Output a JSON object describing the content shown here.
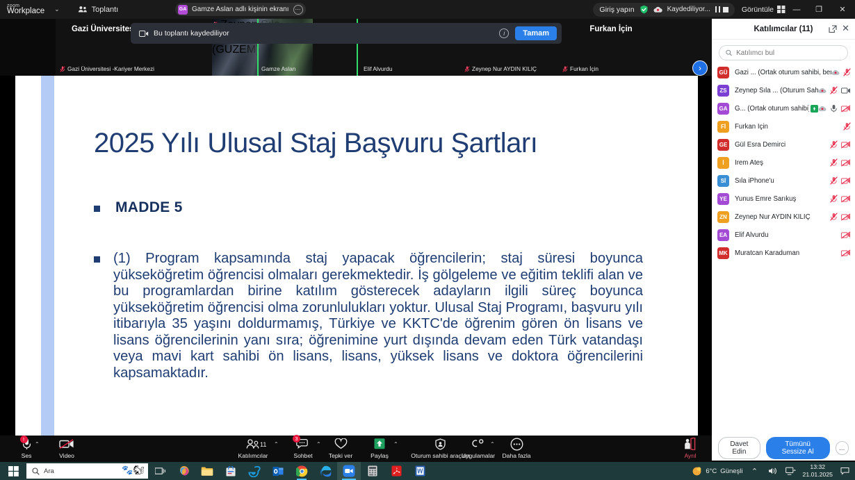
{
  "topbar": {
    "logo_small": "zoom",
    "logo_main": "Workplace",
    "meetings_label": "Toplantı",
    "share_indicator": {
      "initials": "GA",
      "text": "Gamze Aslan adlı kişinin ekranı"
    },
    "signin_label": "Giriş yapın",
    "recording_label": "Kaydediliyor...",
    "view_label": "Görüntüle",
    "window_minimize": "—",
    "window_restore": "❐",
    "window_close": "✕"
  },
  "recording_banner": {
    "text": "Bu toplantı kaydediliyor",
    "info": "i",
    "ok_label": "Tamam"
  },
  "filmstrip": {
    "tiles": [
      {
        "display_name": "Gazi Üniversites...",
        "bottom_name": "Gazi Üniversitesi -Kariyer Merkezi",
        "muted": true,
        "video": false,
        "active": false
      },
      {
        "display_name": "",
        "bottom_name": "Zeynep Sıla PEHLİVAN (GUZEM)",
        "muted": true,
        "video": true,
        "active": false
      },
      {
        "display_name": "Gamze Aslan",
        "bottom_name": "Gamze Aslan",
        "muted": false,
        "video": false,
        "active": true
      },
      {
        "display_name": "Elif Alvurdu",
        "bottom_name": "Elif Alvurdu",
        "muted": false,
        "video": false,
        "active": false
      },
      {
        "display_name": "Zeynep Nur AY...",
        "bottom_name": "Zeynep Nur AYDIN KILIÇ",
        "muted": true,
        "video": false,
        "active": false
      },
      {
        "display_name": "Furkan İçin",
        "bottom_name": "Furkan İçin",
        "muted": true,
        "video": false,
        "active": false
      }
    ],
    "next_arrow": "›"
  },
  "slide": {
    "title": "2025 Yılı Ulusal Staj Başvuru Şartları",
    "bullet1": "MADDE 5",
    "bullet2": "(1) Program kapsamında staj yapacak öğrencilerin; staj süresi boyunca yükseköğretim öğrencisi olmaları gerekmektedir. İş gölgeleme ve eğitim teklifi alan ve bu programlardan birine katılım gösterecek adayların ilgili süreç boyunca yükseköğretim öğrencisi olma zorunlulukları yoktur. Ulusal Staj Programı, başvuru yılı itibarıyla 35 yaşını doldurmamış, Türkiye ve KKTC'de öğrenim gören ön lisans ve lisans öğrencilerinin yanı sıra; öğrenimine yurt dışında devam eden Türk vatandaşı veya mavi kart sahibi ön lisans, lisans, yüksek lisans ve doktora öğrencilerini kapsamaktadır.",
    "accent_color": "#b4cbf5",
    "text_color": "#1f3d73"
  },
  "participants_panel": {
    "title": "Katılımcılar (11)",
    "search_placeholder": "Katılımcı bul",
    "search_value": "",
    "invite_label": "Davet Edin",
    "mute_all_label": "Tümünü Sessize Al",
    "more_label": "...",
    "rows": [
      {
        "initials": "GÜ",
        "color": "#d22d2d",
        "name": "Gazi ...  (Ortak oturum sahibi, ben)",
        "recording": true,
        "mic": "muted",
        "cam": "none",
        "cohost_badge": false
      },
      {
        "initials": "ZS",
        "color": "#7b3fd4",
        "name": "Zeynep Sıla ... (Oturum Sahibi)",
        "recording": true,
        "mic": "muted",
        "cam": "on",
        "cohost_badge": false
      },
      {
        "initials": "GA",
        "color": "#a44bd6",
        "name": "G...  (Ortak oturum sahibi)",
        "recording": true,
        "mic": "on",
        "cam": "off",
        "cohost_badge": true
      },
      {
        "initials": "Fİ",
        "color": "#f0a020",
        "name": "Furkan İçin",
        "recording": false,
        "mic": "muted",
        "cam": "none",
        "cohost_badge": false
      },
      {
        "initials": "GE",
        "color": "#d22d2d",
        "name": "Gül Esra Demirci",
        "recording": false,
        "mic": "muted",
        "cam": "off",
        "cohost_badge": false
      },
      {
        "initials": "İ",
        "color": "#f0a020",
        "name": "İrem Ateş",
        "recording": false,
        "mic": "muted",
        "cam": "off",
        "cohost_badge": false
      },
      {
        "initials": "Sİ",
        "color": "#3a8fd4",
        "name": "Sıla iPhone'u",
        "recording": false,
        "mic": "muted",
        "cam": "off",
        "cohost_badge": false
      },
      {
        "initials": "YE",
        "color": "#a44bd6",
        "name": "Yunus Emre Sarıkuş",
        "recording": false,
        "mic": "muted",
        "cam": "off",
        "cohost_badge": false
      },
      {
        "initials": "ZN",
        "color": "#f0a020",
        "name": "Zeynep Nur AYDIN KILIÇ",
        "recording": false,
        "mic": "muted",
        "cam": "off",
        "cohost_badge": false
      },
      {
        "initials": "EA",
        "color": "#a44bd6",
        "name": "Elif Alvurdu",
        "recording": false,
        "mic": "none",
        "cam": "off",
        "cohost_badge": false
      },
      {
        "initials": "MK",
        "color": "#d22d2d",
        "name": "Muratcan Karaduman",
        "recording": false,
        "mic": "none",
        "cam": "off",
        "cohost_badge": false
      }
    ]
  },
  "meeting_toolbar": {
    "audio_label": "Ses",
    "audio_badge": "!",
    "video_label": "Video",
    "participants_label": "Katılımcılar",
    "participants_count": "11",
    "chat_label": "Sohbet",
    "chat_badge": "3",
    "reactions_label": "Tepki ver",
    "share_label": "Paylaş",
    "host_tools_label": "Oturum sahibi araçları",
    "apps_label": "Uygulamalar",
    "more_label": "Daha fazla",
    "leave_label": "Ayrıl"
  },
  "taskbar": {
    "search_placeholder": "Ara",
    "weather_temp": "6°C",
    "weather_text": "Güneşli",
    "time": "13:32",
    "date": "21.01.2025",
    "apps": [
      "task-view",
      "copilot",
      "file-explorer",
      "microsoft-store",
      "internet-explorer",
      "outlook",
      "chrome",
      "edge",
      "zoom",
      "calculator",
      "acrobat-reader",
      "word"
    ]
  }
}
